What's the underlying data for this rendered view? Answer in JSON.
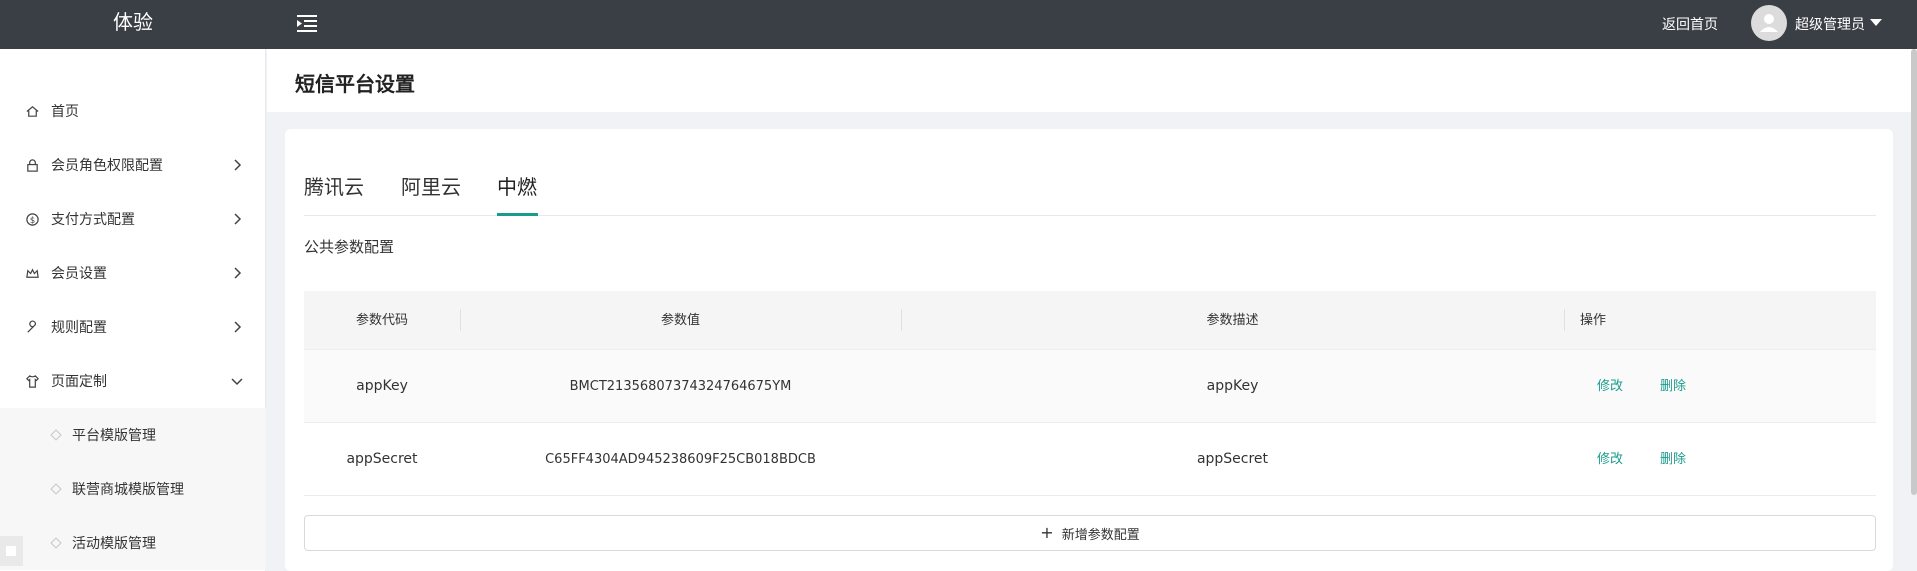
{
  "header": {
    "brand": "体验",
    "back_home": "返回首页",
    "username": "超级管理员"
  },
  "sidebar": {
    "items": [
      {
        "label": "首页",
        "icon": "home-icon",
        "has_chevron": false
      },
      {
        "label": "会员角色权限配置",
        "icon": "lock-icon",
        "has_chevron": true
      },
      {
        "label": "支付方式配置",
        "icon": "dollar-circle-icon",
        "has_chevron": true
      },
      {
        "label": "会员设置",
        "icon": "crown-icon",
        "has_chevron": true
      },
      {
        "label": "规则配置",
        "icon": "wrench-icon",
        "has_chevron": true
      },
      {
        "label": "页面定制",
        "icon": "shirt-icon",
        "has_chevron": true,
        "expanded": true
      }
    ],
    "sub_items": [
      {
        "label": "平台模版管理"
      },
      {
        "label": "联营商城模版管理"
      },
      {
        "label": "活动模版管理"
      }
    ]
  },
  "page": {
    "title": "短信平台设置"
  },
  "tabs": [
    {
      "label": "腾讯云",
      "active": false
    },
    {
      "label": "阿里云",
      "active": false
    },
    {
      "label": "中燃",
      "active": true
    }
  ],
  "section": {
    "title": "公共参数配置"
  },
  "table": {
    "columns": [
      "参数代码",
      "参数值",
      "参数描述",
      "操作"
    ],
    "rows": [
      {
        "code": "appKey",
        "value": "BMCT21356807374324764675YM",
        "desc": "appKey",
        "edit": "修改",
        "delete": "删除"
      },
      {
        "code": "appSecret",
        "value": "C65FF4304AD945238609F25CB018BDCB",
        "desc": "appSecret",
        "edit": "修改",
        "delete": "删除"
      }
    ]
  },
  "add_button": {
    "label": "新增参数配置"
  },
  "colors": {
    "topbar": "#3a3f46",
    "accent": "#1a9c8d"
  }
}
